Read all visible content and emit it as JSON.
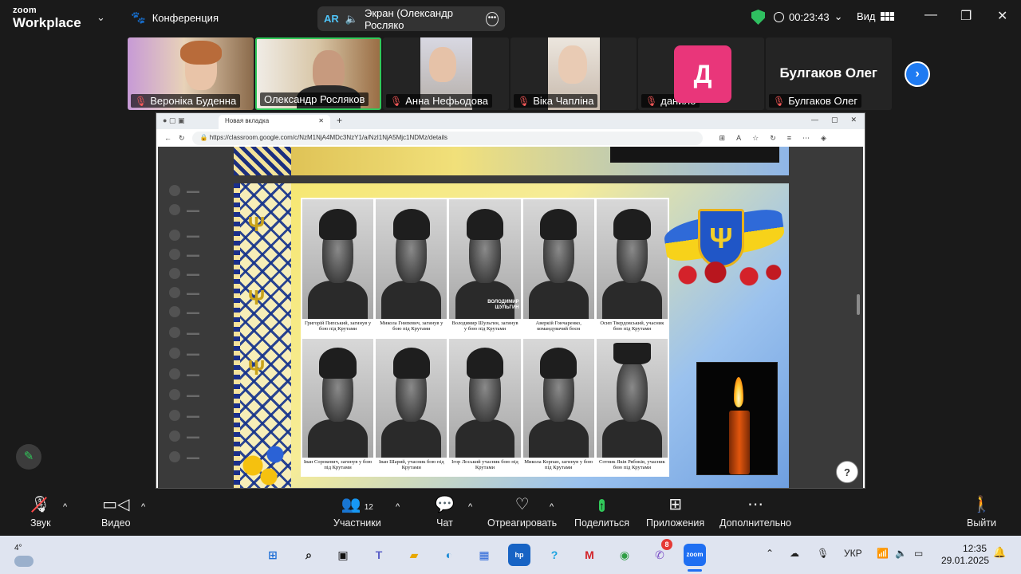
{
  "app": {
    "logo_line1": "zoom",
    "logo_line2": "Workplace",
    "meeting_label": "Конференция",
    "screen_share_label": "Экран (Олександр Росляко",
    "ar_label": "AR",
    "timer": "00:23:43",
    "view_label": "Вид"
  },
  "participants": [
    {
      "name": "Вероніка Буденна",
      "muted": true
    },
    {
      "name": "Олександр Росляков",
      "muted": false,
      "active": true
    },
    {
      "name": "Анна Нефьодова",
      "muted": true
    },
    {
      "name": "Віка Чапліна",
      "muted": true
    },
    {
      "name": "данило",
      "muted": true,
      "avatar_letter": "Д",
      "avatar_color": "#e9367a"
    },
    {
      "name": "Булгаков Олег",
      "muted": true,
      "big_name": "Булгаков Олег"
    }
  ],
  "browser": {
    "tab_title": "Новая вкладка",
    "url": "https://classroom.google.com/c/NzM1NjA4MDc3NzY1/a/NzI1NjA5Mjc1NDMz/details"
  },
  "slide": {
    "photos": [
      {
        "caption": "Григорій Пипський, загинув у бою під Крутами"
      },
      {
        "caption": "Микола Гнипевич, загинув у бою під Крутами"
      },
      {
        "caption": "Володимир Шульгин, загинув у бою під Крутами",
        "overlay": "ВОЛОДИМИР ШУЛЬГИН"
      },
      {
        "caption": "Аверкій Гончаренко, командувачий боєм"
      },
      {
        "caption": "Осип Твердовський, учасник бою під Крутами"
      },
      {
        "caption": "Іван Сорокевич, загинув у бою під Крутами"
      },
      {
        "caption": "Іван Шарий, учасник бою під Крутами"
      },
      {
        "caption": "Ігор Лоський учасник бою під Крутами"
      },
      {
        "caption": "Микола Корпан, загинув у бою під Крутами"
      },
      {
        "caption": "Сотник Яків Рябоків, учасник бою під Крутами"
      }
    ]
  },
  "toolbar": {
    "audio": "Звук",
    "video": "Видео",
    "participants": "Участники",
    "participants_count": "12",
    "chat": "Чат",
    "react": "Отреагировать",
    "share": "Поделиться",
    "apps": "Приложения",
    "more": "Дополнительно",
    "leave": "Выйти"
  },
  "taskbar": {
    "weather_temp": "4°",
    "viber_badge": "8",
    "language": "УКР",
    "time": "12:35",
    "date": "29.01.2025"
  },
  "colors": {
    "accent_green": "#31c85a",
    "share_blue": "#1f7bf2",
    "leave_red": "#ff4a4a"
  }
}
